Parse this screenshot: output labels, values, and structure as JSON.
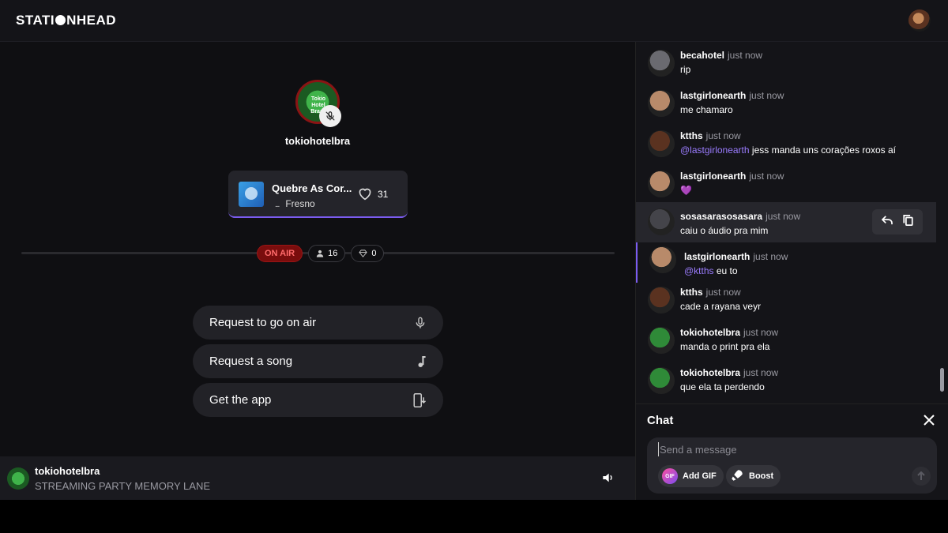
{
  "header": {
    "logo_text_a": "STATI",
    "logo_text_b": "NHEAD"
  },
  "stage": {
    "host_name": "tokiohotelbra",
    "host_avatar_text": "Tokio Hotel Brasil",
    "now_playing": {
      "title": "Quebre As Cor...",
      "artist": "Fresno",
      "eq_glyph": "...",
      "likes": "31"
    },
    "status": {
      "on_air": "ON AIR",
      "listeners": "16",
      "diamonds": "0"
    },
    "actions": [
      {
        "label": "Request to go on air",
        "icon": "mic-icon"
      },
      {
        "label": "Request a song",
        "icon": "music-note-icon"
      },
      {
        "label": "Get the app",
        "icon": "phone-download-icon"
      }
    ]
  },
  "bottom_bar": {
    "host": "tokiohotelbra",
    "description": "STREAMING PARTY MEMORY LANE"
  },
  "chat": {
    "messages": [
      {
        "user": "becahotel",
        "time": "just now",
        "text": "rip",
        "mention": "",
        "avatar_color": "#6a6a70"
      },
      {
        "user": "lastgirlonearth",
        "time": "just now",
        "text": "me chamaro",
        "mention": "",
        "avatar_color": "#b88a6a"
      },
      {
        "user": "ktths",
        "time": "just now",
        "text": "jess manda uns corações roxos aí",
        "mention": "@lastgirlonearth",
        "avatar_color": "#5a3220"
      },
      {
        "user": "lastgirlonearth",
        "time": "just now",
        "text": "💜",
        "mention": "",
        "avatar_color": "#b88a6a"
      },
      {
        "user": "sosasarasosasara",
        "time": "just now",
        "text": "caiu o áudio pra mim",
        "mention": "",
        "avatar_color": "#44444a"
      },
      {
        "user": "lastgirlonearth",
        "time": "just now",
        "text": "eu to",
        "mention": "@ktths",
        "avatar_color": "#b88a6a"
      },
      {
        "user": "ktths",
        "time": "just now",
        "text": "cade a rayana veyr",
        "mention": "",
        "avatar_color": "#5a3220"
      },
      {
        "user": "tokiohotelbra",
        "time": "just now",
        "text": "manda o print pra ela",
        "mention": "",
        "avatar_color": "#2f8a38"
      },
      {
        "user": "tokiohotelbra",
        "time": "just now",
        "text": "que ela ta perdendo",
        "mention": "",
        "avatar_color": "#2f8a38"
      }
    ],
    "title": "Chat",
    "input_placeholder": "Send a message",
    "gif_badge": "GIF",
    "add_gif_label": "Add GIF",
    "boost_label": "Boost"
  },
  "colors": {
    "accent": "#7b5cf0",
    "on_air_bg": "#7a0d0d",
    "on_air_text": "#ff6b6b",
    "mention": "#9b7cff"
  }
}
